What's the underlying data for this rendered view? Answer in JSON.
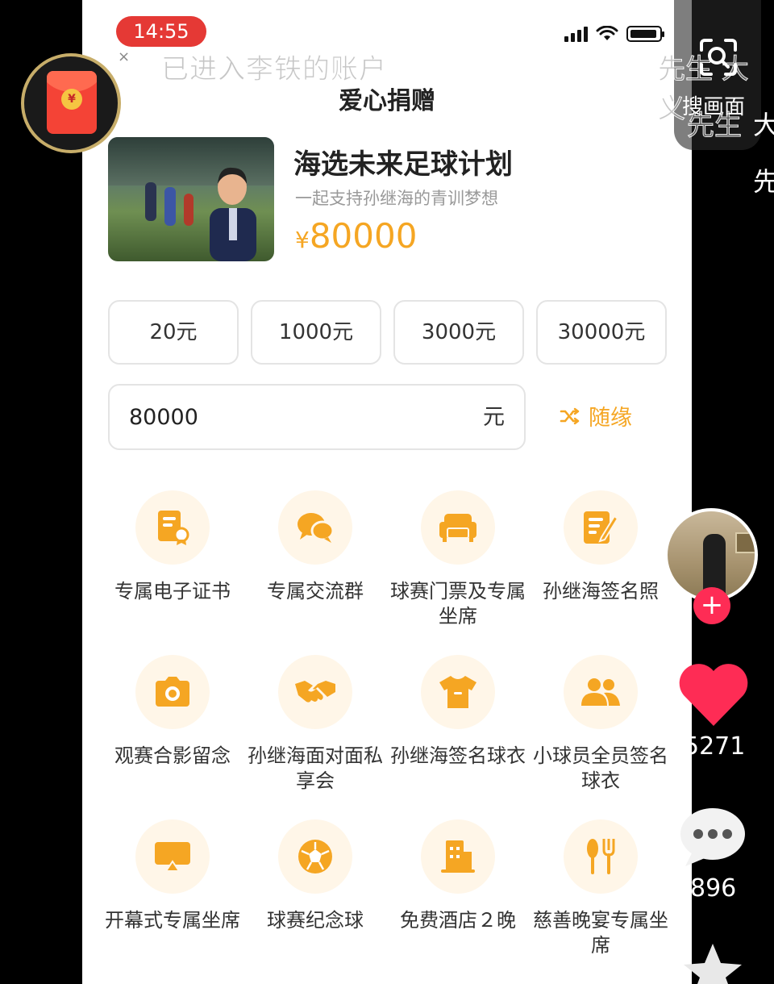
{
  "status_bar": {
    "time": "14:55"
  },
  "overlay": {
    "account_note": "已进入李铁的账户",
    "search_label": "搜画面",
    "ghost_top": "先生 大 义",
    "ghost_bottom": "先生",
    "side_char_1": "大",
    "side_char_2": "先"
  },
  "header": {
    "title": "爱心捐赠",
    "back_icon": "chevron-left-icon"
  },
  "project": {
    "title": "海选未来足球计划",
    "subtitle": "一起支持孙继海的青训梦想",
    "currency": "¥",
    "amount": "80000"
  },
  "presets": [
    "20元",
    "1000元",
    "3000元",
    "30000元"
  ],
  "custom_amount": {
    "value": "80000",
    "unit": "元"
  },
  "random_button": {
    "label": "随缘",
    "icon": "shuffle-icon"
  },
  "benefits": [
    {
      "label": "专属电子证书",
      "icon": "certificate-icon"
    },
    {
      "label": "专属交流群",
      "icon": "chat-group-icon"
    },
    {
      "label": "球赛门票及专属坐席",
      "icon": "sofa-seat-icon"
    },
    {
      "label": "孙继海签名照",
      "icon": "signed-photo-icon"
    },
    {
      "label": "观赛合影留念",
      "icon": "camera-icon"
    },
    {
      "label": "孙继海面对面私享会",
      "icon": "handshake-icon"
    },
    {
      "label": "孙继海签名球衣",
      "icon": "jersey-icon"
    },
    {
      "label": "小球员全员签名球衣",
      "icon": "people-icon"
    },
    {
      "label": "开幕式专属坐席",
      "icon": "screen-icon"
    },
    {
      "label": "球赛纪念球",
      "icon": "football-icon"
    },
    {
      "label": "免费酒店２晚",
      "icon": "hotel-icon"
    },
    {
      "label": "慈善晚宴专属坐席",
      "icon": "dinner-icon"
    }
  ],
  "social": {
    "likes": "5271",
    "comments": "896"
  },
  "colors": {
    "accent": "#f5a623",
    "time_pill": "#e53935",
    "like": "#fe2c55"
  }
}
